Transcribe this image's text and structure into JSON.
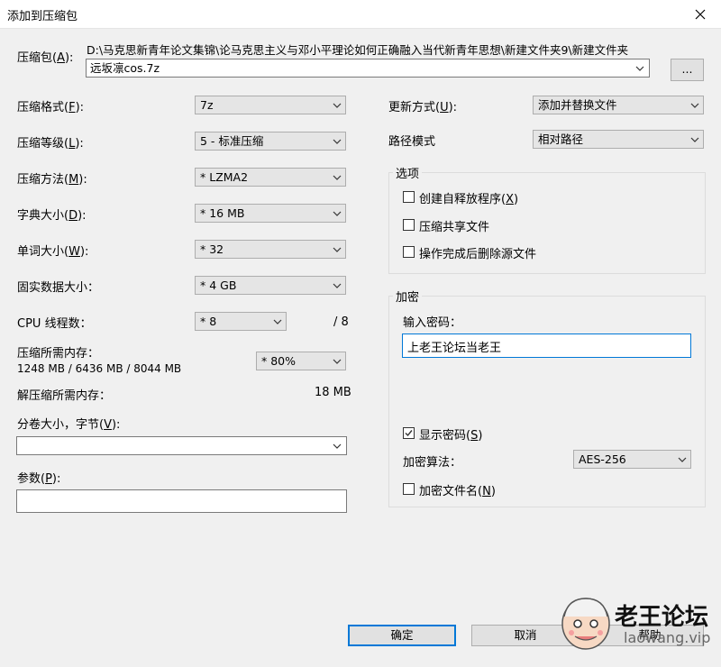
{
  "window": {
    "title": "添加到压缩包"
  },
  "archive": {
    "label": "压缩包(A):",
    "path": "D:\\马克思新青年论文集锦\\论马克思主义与邓小平理论如何正确融入当代新青年思想\\新建文件夹9\\新建文件夹",
    "name": "远坂凛cos.7z",
    "browse_label": "..."
  },
  "left": {
    "format": {
      "label": "压缩格式(F):",
      "value": "7z"
    },
    "level": {
      "label": "压缩等级(L):",
      "value": "5 - 标准压缩"
    },
    "method": {
      "label": "压缩方法(M):",
      "value": "* LZMA2"
    },
    "dict": {
      "label": "字典大小(D):",
      "value": "* 16 MB"
    },
    "word": {
      "label": "单词大小(W):",
      "value": "* 32"
    },
    "solid": {
      "label": "固实数据大小：",
      "value": "* 4 GB"
    },
    "threads": {
      "label": "CPU 线程数：",
      "value": "* 8",
      "max": "/ 8"
    },
    "mem_compress": {
      "label": "压缩所需内存：",
      "detail": "1248 MB / 6436 MB / 8044 MB",
      "value": "* 80%"
    },
    "mem_decompress": {
      "label": "解压缩所需内存：",
      "value": "18 MB"
    },
    "volume": {
      "label": "分卷大小，字节(V):",
      "value": ""
    },
    "params": {
      "label": "参数(P):",
      "value": ""
    }
  },
  "right": {
    "update": {
      "label": "更新方式(U):",
      "value": "添加并替换文件"
    },
    "pathmode": {
      "label": "路径模式",
      "value": "相对路径"
    },
    "options": {
      "title": "选项",
      "sfx": {
        "label": "创建自释放程序(X)",
        "checked": false
      },
      "shared": {
        "label": "压缩共享文件",
        "checked": false
      },
      "delete": {
        "label": "操作完成后删除源文件",
        "checked": false
      }
    },
    "encryption": {
      "title": "加密",
      "password_label": "输入密码：",
      "password_value": "上老王论坛当老王",
      "show_password": {
        "label": "显示密码(S)",
        "checked": true
      },
      "method_label": "加密算法：",
      "method_value": "AES-256",
      "encrypt_names": {
        "label": "加密文件名(N)",
        "checked": false
      }
    }
  },
  "buttons": {
    "ok": "确定",
    "cancel": "取消",
    "help": "帮助"
  },
  "watermark": {
    "name": "老王论坛",
    "url": "laowang.vip"
  }
}
